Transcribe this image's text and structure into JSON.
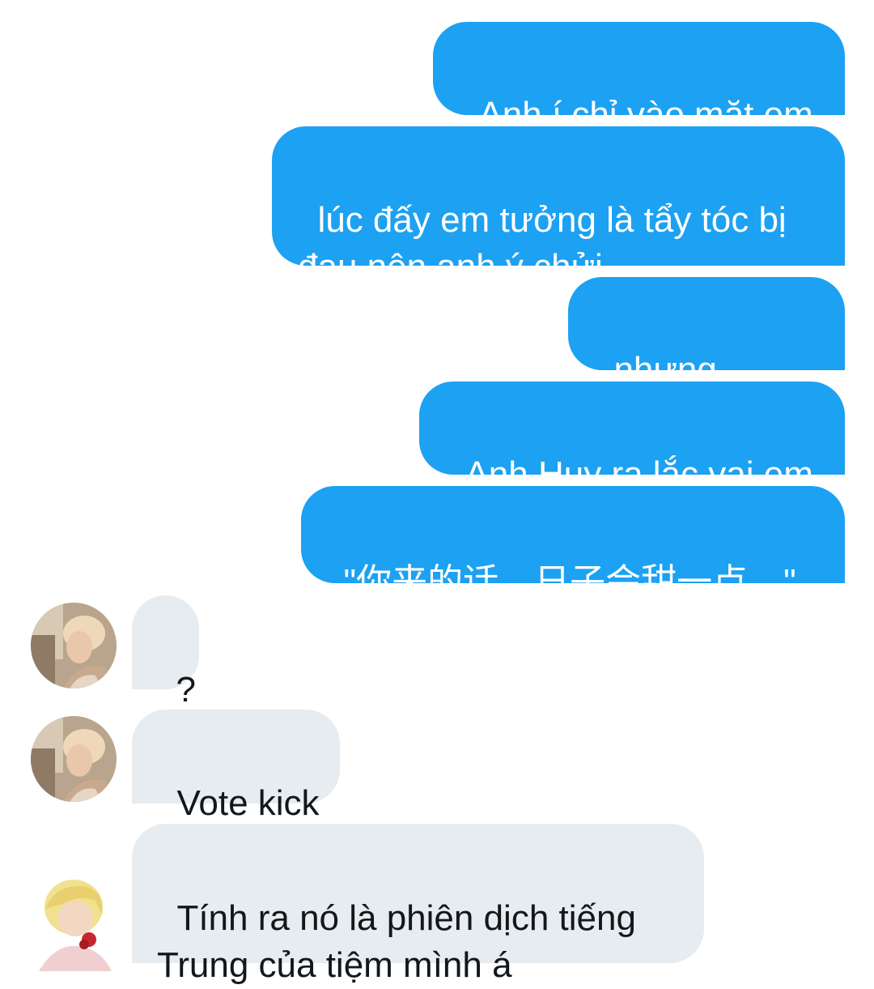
{
  "conversation": {
    "messages": [
      {
        "direction": "outgoing",
        "text": "Anh í chỉ vào mặt em"
      },
      {
        "direction": "outgoing",
        "text": "lúc đấy em tưởng là tẩy tóc bị\nđau nên anh ý chửi"
      },
      {
        "direction": "outgoing",
        "text": "nhưng không"
      },
      {
        "direction": "outgoing",
        "text": "Anh Huy ra lắc vai em"
      },
      {
        "direction": "outgoing",
        "text": "\"你来的话，日子会甜一点。\""
      },
      {
        "direction": "incoming",
        "text": "?",
        "avatar": "user-avatar-a"
      },
      {
        "direction": "incoming",
        "text": "Vote kick",
        "avatar": "user-avatar-a"
      },
      {
        "direction": "incoming",
        "text": "Tính ra nó là phiên dịch tiếng\nTrung của tiệm mình á",
        "avatar": "user-avatar-b"
      }
    ]
  },
  "colors": {
    "outgoing_bubble": "#1da1f2",
    "incoming_bubble": "#e6ecf0",
    "outgoing_text": "#ffffff",
    "incoming_text": "#14171a"
  }
}
